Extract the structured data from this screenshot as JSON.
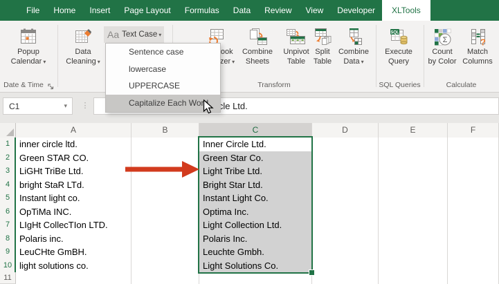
{
  "tabs": {
    "active": "XLTools",
    "items": [
      "File",
      "Home",
      "Insert",
      "Page Layout",
      "Formulas",
      "Data",
      "Review",
      "View",
      "Developer",
      "XLTools"
    ]
  },
  "ribbon": {
    "text_case": {
      "prefix": "Aa",
      "label": "Text Case"
    },
    "buttons": {
      "popup_calendar": {
        "line1": "Popup",
        "line2": "Calendar"
      },
      "data_cleaning": {
        "line1": "Data",
        "line2": "Cleaning"
      },
      "workbook_organizer": {
        "line1": "Workbook",
        "line2": "Organizer"
      },
      "combine_sheets": {
        "line1": "Combine",
        "line2": "Sheets"
      },
      "unpivot_table": {
        "line1": "Unpivot",
        "line2": "Table"
      },
      "split_table": {
        "line1": "Split",
        "line2": "Table"
      },
      "combine_data": {
        "line1": "Combine",
        "line2": "Data"
      },
      "execute_query": {
        "line1": "Execute",
        "line2": "Query"
      },
      "count_by_color": {
        "line1": "Count",
        "line2": "by Color"
      },
      "match_columns": {
        "line1": "Match",
        "line2": "Columns"
      }
    },
    "group_labels": {
      "date_time": "Date & Time",
      "transform": "Transform",
      "sql_queries": "SQL Queries",
      "calculate": "Calculate"
    }
  },
  "text_case_menu": {
    "items": [
      "Sentence case",
      "lowercase",
      "UPPERCASE",
      "Capitalize Each Word"
    ],
    "highlighted": "Capitalize Each Word"
  },
  "formula_bar": {
    "name_box": "C1",
    "value": "Inner Circle Ltd."
  },
  "sheet": {
    "column_headers": [
      "A",
      "B",
      "C",
      "D",
      "E",
      "F"
    ],
    "selected_column": "C",
    "selected_range": "C1:C10",
    "rows": [
      {
        "n": "1",
        "a": "inner circle ltd.",
        "c": "Inner Circle Ltd."
      },
      {
        "n": "2",
        "a": "Green STAR CO.",
        "c": "Green Star Co."
      },
      {
        "n": "3",
        "a": "LiGHt TriBe Ltd.",
        "c": "Light Tribe Ltd."
      },
      {
        "n": "4",
        "a": "bright StaR LTd.",
        "c": "Bright Star Ltd."
      },
      {
        "n": "5",
        "a": "Instant light co.",
        "c": "Instant Light Co."
      },
      {
        "n": "6",
        "a": "OpTiMa INC.",
        "c": "Optima Inc."
      },
      {
        "n": "7",
        "a": "LIgHt CollecTIon LTD.",
        "c": "Light Collection Ltd."
      },
      {
        "n": "8",
        "a": "Polaris inc.",
        "c": "Polaris Inc."
      },
      {
        "n": "9",
        "a": "LeuCHte GmBH.",
        "c": "Leuchte Gmbh."
      },
      {
        "n": "10",
        "a": "light solutions co.",
        "c": "Light Solutions Co."
      }
    ],
    "next_row_number": "11"
  },
  "colors": {
    "excel_green": "#217346",
    "selection_fill": "#d2d2d2",
    "arrow_red": "#d23b1e",
    "accent_orange": "#ed7d31"
  }
}
